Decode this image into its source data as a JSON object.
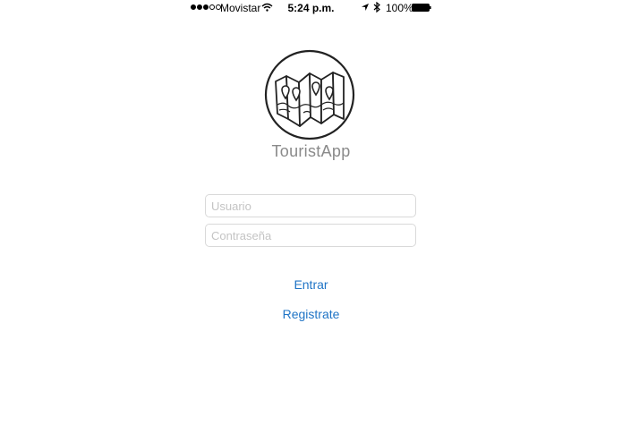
{
  "status_bar": {
    "carrier": "Movistar",
    "time": "5:24 p.m.",
    "battery": "100%",
    "signal_bars": 3,
    "signal_total": 5
  },
  "app": {
    "name": "TouristApp",
    "logo_icon": "folded-map-icon"
  },
  "form": {
    "username_placeholder": "Usuario",
    "password_placeholder": "Contraseña",
    "login_label": "Entrar",
    "register_label": "Registrate"
  },
  "colors": {
    "accent": "#1f74c6",
    "placeholder": "#c4c4c4",
    "app_name": "#8a8a8a"
  }
}
